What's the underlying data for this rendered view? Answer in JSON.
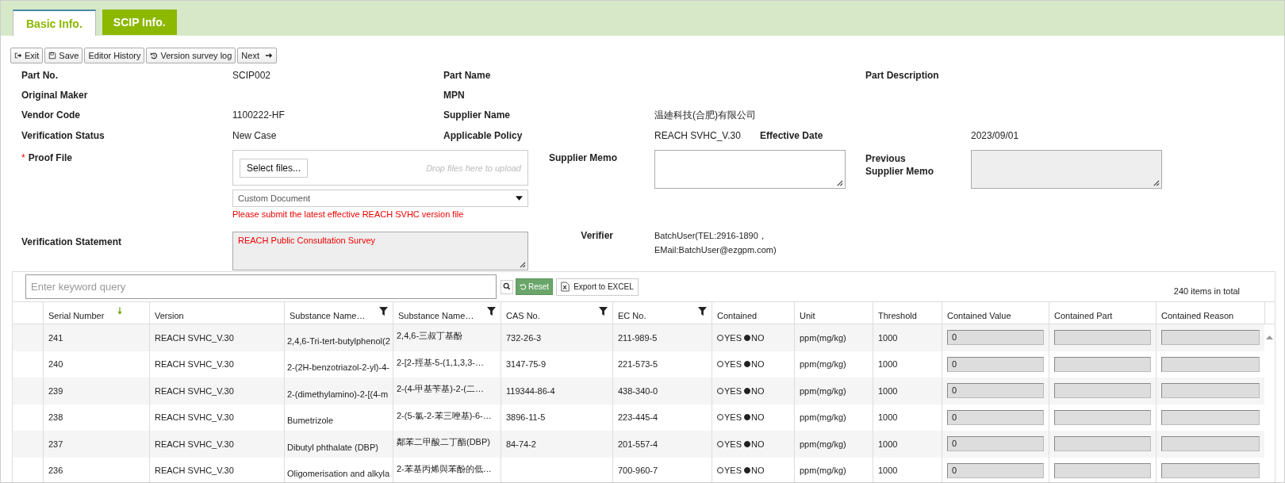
{
  "tabs": [
    {
      "label": "Basic Info.",
      "selected": true
    },
    {
      "label": "SCIP Info.",
      "selected": false
    }
  ],
  "toolbar": [
    {
      "label": "Exit",
      "kind": "exit"
    },
    {
      "label": "Save",
      "kind": "save"
    },
    {
      "label": "Editor History",
      "kind": "plain"
    },
    {
      "label": "Version survey log",
      "kind": "history"
    },
    {
      "label": "Next",
      "kind": "next"
    }
  ],
  "form": {
    "part_no": {
      "label": "Part No.",
      "value": "SCIP002"
    },
    "part_name": {
      "label": "Part Name"
    },
    "part_description": {
      "label": "Part Description"
    },
    "original_maker": {
      "label": "Original Maker"
    },
    "mpn": {
      "label": "MPN"
    },
    "vendor_code": {
      "label": "Vendor Code",
      "value": "1100222-HF"
    },
    "supplier_name": {
      "label": "Supplier Name",
      "value": "温廸科技(合肥)有限公司"
    },
    "verification_status": {
      "label": "Verification Status",
      "value": "New Case"
    },
    "applicable_policy": {
      "label": "Applicable Policy",
      "value": "REACH SVHC_V.30"
    },
    "effective_date": {
      "label": "Effective Date",
      "value": "2023/09/01"
    },
    "proof_file": {
      "label": "Proof File",
      "required_mark": "*",
      "select_button": "Select files...",
      "drop_hint": "Drop files here to upload",
      "document_type": "Custom Document",
      "warning": "Please submit the latest effective REACH SVHC version file"
    },
    "supplier_memo": {
      "label": "Supplier Memo"
    },
    "previous_supplier_memo": {
      "label": "Previous Supplier Memo",
      "disabled": true
    },
    "verification_statement": {
      "label": "Verification Statement",
      "value": "REACH Public Consultation Survey"
    },
    "verifier": {
      "label": "Verifier",
      "lines": [
        "BatchUser(TEL:2916-1890，",
        "EMail:BatchUser@ezgpm.com)"
      ]
    }
  },
  "table": {
    "search": {
      "placeholder": "Enter keyword query"
    },
    "reset": "Reset",
    "export": "Export to EXCEL",
    "total": "240 items in total",
    "columns": [
      {
        "label": "Serial Number",
        "sorted": true,
        "filter": false
      },
      {
        "label": "Version",
        "sorted": false,
        "filter": false
      },
      {
        "label": "Substance Name…",
        "sorted": false,
        "filter": true
      },
      {
        "label": "Substance Name…",
        "sorted": false,
        "filter": true
      },
      {
        "label": "CAS No.",
        "sorted": false,
        "filter": true
      },
      {
        "label": "EC No.",
        "sorted": false,
        "filter": true
      },
      {
        "label": "Contained",
        "sorted": false,
        "filter": false
      },
      {
        "label": "Unit",
        "sorted": false,
        "filter": false
      },
      {
        "label": "Threshold",
        "sorted": false,
        "filter": false
      },
      {
        "label": "Contained Value",
        "sorted": false,
        "filter": false
      },
      {
        "label": "Contained Part",
        "sorted": false,
        "filter": false
      },
      {
        "label": "Contained Reason",
        "sorted": false,
        "filter": false
      }
    ],
    "rows": [
      {
        "serial": "241",
        "version": "REACH SVHC_V.30",
        "substance_en": "2,4,6-Tri-tert-butylphenol(2",
        "substance_zh": "2,4,6-三叔丁基酚",
        "cas": "732-26-3",
        "ec": "211-989-5",
        "contained": [
          {
            "label": "YES",
            "selected": false
          },
          {
            "label": "NO",
            "selected": true
          }
        ],
        "unit": "ppm(mg/kg)",
        "threshold": "1000",
        "contained_value": "0"
      },
      {
        "serial": "240",
        "version": "REACH SVHC_V.30",
        "substance_en": "2-(2H-benzotriazol-2-yl)-4-",
        "substance_zh": "2-[2-羥基-5-(1,1,3,3-…",
        "cas": "3147-75-9",
        "ec": "221-573-5",
        "contained": [
          {
            "label": "YES",
            "selected": false
          },
          {
            "label": "NO",
            "selected": true
          }
        ],
        "unit": "ppm(mg/kg)",
        "threshold": "1000",
        "contained_value": "0"
      },
      {
        "serial": "239",
        "version": "REACH SVHC_V.30",
        "substance_en": "2-(dimethylamino)-2-[(4-m",
        "substance_zh": "2-(4-甲基苄基)-2-(二…",
        "cas": "119344-86-4",
        "ec": "438-340-0",
        "contained": [
          {
            "label": "YES",
            "selected": false
          },
          {
            "label": "NO",
            "selected": true
          }
        ],
        "unit": "ppm(mg/kg)",
        "threshold": "1000",
        "contained_value": "0"
      },
      {
        "serial": "238",
        "version": "REACH SVHC_V.30",
        "substance_en": "Bumetrizole",
        "substance_zh": "2-(5-氯-2-苯三唑基)-6-…",
        "cas": "3896-11-5",
        "ec": "223-445-4",
        "contained": [
          {
            "label": "YES",
            "selected": false
          },
          {
            "label": "NO",
            "selected": true
          }
        ],
        "unit": "ppm(mg/kg)",
        "threshold": "1000",
        "contained_value": "0"
      },
      {
        "serial": "237",
        "version": "REACH SVHC_V.30",
        "substance_en": "Dibutyl phthalate (DBP)",
        "substance_zh": "鄰苯二甲酸二丁酯(DBP)",
        "cas": "84-74-2",
        "ec": "201-557-4",
        "contained": [
          {
            "label": "YES",
            "selected": false
          },
          {
            "label": "NO",
            "selected": true
          }
        ],
        "unit": "ppm(mg/kg)",
        "threshold": "1000",
        "contained_value": "0"
      },
      {
        "serial": "236",
        "version": "REACH SVHC_V.30",
        "substance_en": "Oligomerisation and alkyla",
        "substance_zh": "2-苯基丙烯與苯酚的低…",
        "ec": "700-960-7",
        "contained": [
          {
            "label": "YES",
            "selected": false
          },
          {
            "label": "NO",
            "selected": true
          }
        ],
        "unit": "ppm(mg/kg)",
        "threshold": "1000",
        "contained_value": "0"
      }
    ]
  }
}
